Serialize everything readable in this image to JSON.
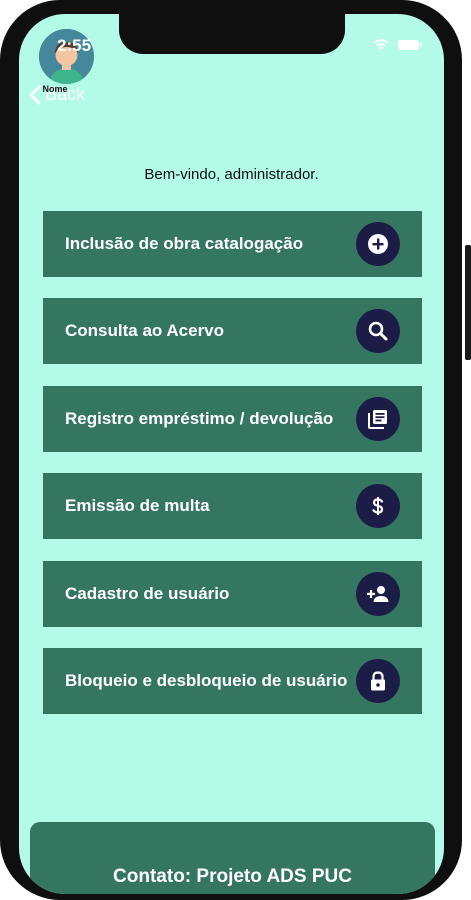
{
  "status_bar": {
    "time": "2:55"
  },
  "header": {
    "avatar_name": "Nome",
    "back_label": "Back"
  },
  "welcome": "Bem-vindo, administrador.",
  "menu": [
    {
      "label": "Inclusão de obra catalogação",
      "icon": "add-circle-icon"
    },
    {
      "label": "Consulta ao Acervo",
      "icon": "search-icon"
    },
    {
      "label": "Registro empréstimo / devolução",
      "icon": "library-books-icon"
    },
    {
      "label": "Emissão de multa",
      "icon": "dollar-icon"
    },
    {
      "label": "Cadastro de usuário",
      "icon": "person-add-icon"
    },
    {
      "label": "Bloqueio e desbloqueio de usuário",
      "icon": "lock-icon"
    }
  ],
  "footer": {
    "text": "Contato: Projeto ADS PUC"
  },
  "colors": {
    "background": "#b3fbe6",
    "button": "#357660",
    "icon_circle": "#1c1d47",
    "text_light": "#ffffff"
  }
}
